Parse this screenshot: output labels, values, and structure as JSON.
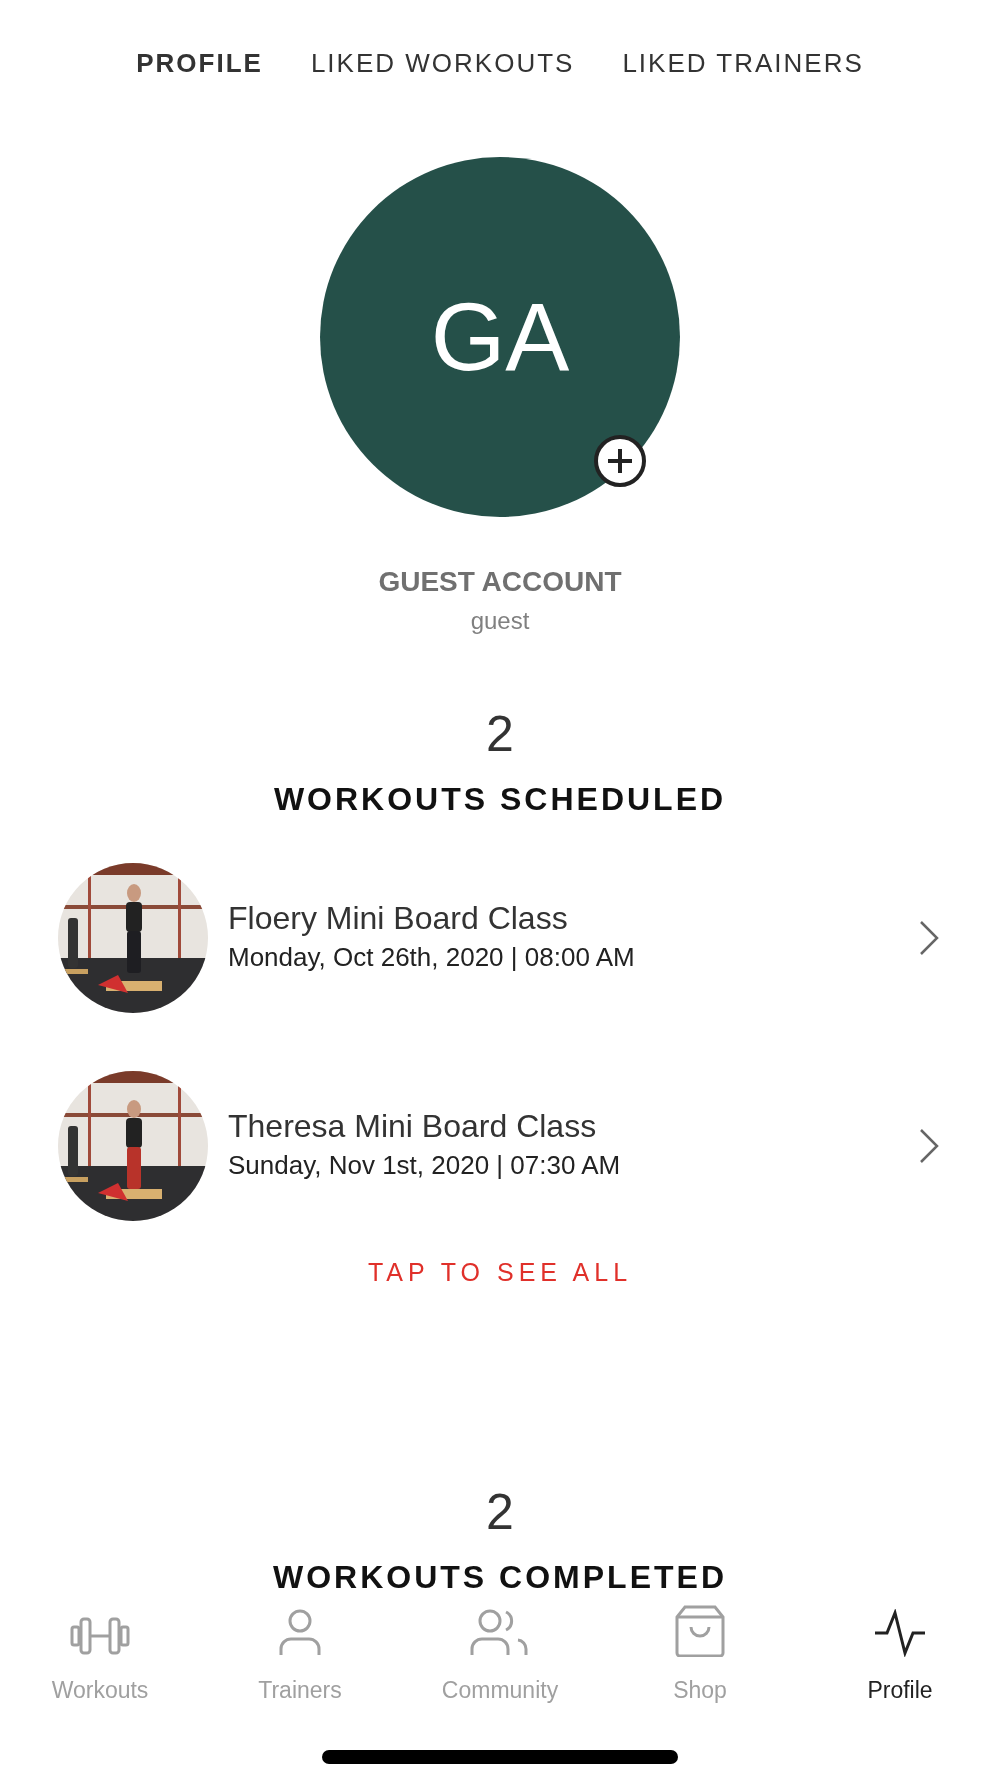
{
  "tabs": [
    {
      "label": "PROFILE",
      "selected": true
    },
    {
      "label": "LIKED WORKOUTS",
      "selected": false
    },
    {
      "label": "LIKED TRAINERS",
      "selected": false
    }
  ],
  "avatar": {
    "initials": "GA"
  },
  "user": {
    "name": "GUEST ACCOUNT",
    "username": "guest"
  },
  "scheduled": {
    "count": "2",
    "heading": "WORKOUTS SCHEDULED",
    "items": [
      {
        "title": "Floery Mini Board Class",
        "datetime": "Monday, Oct 26th, 2020 | 08:00 AM"
      },
      {
        "title": "Theresa Mini Board Class",
        "datetime": "Sunday, Nov 1st, 2020 | 07:30 AM"
      }
    ],
    "link": "TAP TO SEE ALL"
  },
  "completed": {
    "count": "2",
    "heading": "WORKOUTS COMPLETED"
  },
  "nav": [
    {
      "label": "Workouts",
      "selected": false
    },
    {
      "label": "Trainers",
      "selected": false
    },
    {
      "label": "Community",
      "selected": false
    },
    {
      "label": "Shop",
      "selected": false
    },
    {
      "label": "Profile",
      "selected": true
    }
  ]
}
